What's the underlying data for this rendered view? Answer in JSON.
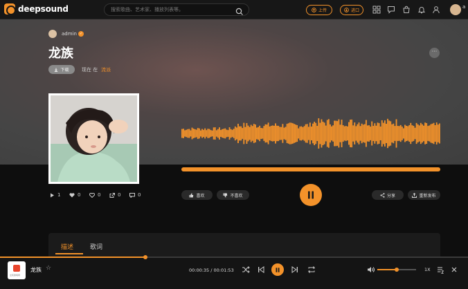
{
  "brand": {
    "name": "deepsound",
    "accent": "#f3922a"
  },
  "search": {
    "placeholder": "搜索歌曲、艺术家、播放列表等。"
  },
  "header": {
    "upload_label": "上传",
    "import_label": "进口",
    "user_name": "a"
  },
  "track": {
    "author": "admin",
    "title": "龙族",
    "download_label": "下载",
    "now_label": "现在 在",
    "now_value": "流派"
  },
  "stats": {
    "plays": "1",
    "likes": "0",
    "dislikes": "0",
    "shares": "0",
    "comments": "0"
  },
  "actions": {
    "like": "喜欢",
    "dislike": "不喜欢",
    "share": "分享",
    "repost": "重新发布"
  },
  "tabs": [
    {
      "label": "描述"
    },
    {
      "label": "歌词"
    }
  ],
  "player": {
    "title": "龙族",
    "time": "00:00:35 / 00:01:53",
    "progress": 0.31,
    "volume": 0.5,
    "speed": "1X",
    "cover_caption": "全民歌唱网"
  },
  "icons": {
    "search": "search-icon",
    "upload": "upload-icon",
    "import": "import-icon",
    "grid": "grid-icon",
    "chat": "chat-icon",
    "store": "store-icon",
    "bell": "bell-icon",
    "user": "user-icon",
    "more": "more-icon",
    "play": "play-icon",
    "heart": "heart-icon",
    "dislike": "dislike-icon",
    "share": "share-icon",
    "comment": "comment-icon",
    "pause": "pause-icon",
    "shuffle": "shuffle-icon",
    "prev": "previous-icon",
    "next": "next-icon",
    "repeat": "repeat-icon",
    "volume": "volume-icon",
    "queue": "queue-icon",
    "close": "close-icon",
    "star": "star-icon"
  }
}
